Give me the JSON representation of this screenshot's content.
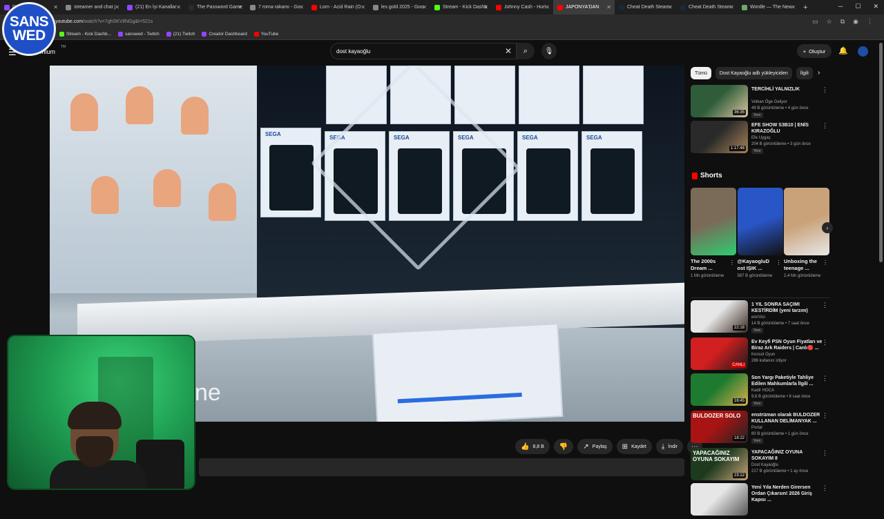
{
  "browser": {
    "tabs": [
      {
        "label": "Dash",
        "color": "#9146ff"
      },
      {
        "label": "streamer and chat j",
        "color": "#888888"
      },
      {
        "label": "(21) En İyi Kanallar",
        "color": "#9146ff"
      },
      {
        "label": "The Password Game",
        "color": "#2b2b2b"
      },
      {
        "label": "7 roma rakamı - Go",
        "color": "#888888"
      },
      {
        "label": "Lorn - Acid Rain (O",
        "color": "#ff0000"
      },
      {
        "label": "les gold 2025 - Goo",
        "color": "#888888"
      },
      {
        "label": "Stream - Kick Dashb",
        "color": "#53fc18"
      },
      {
        "label": "Johnny Cash - Hurt",
        "color": "#ff0000"
      },
      {
        "label": "JAPONYA'DAN",
        "color": "#ff0000"
      },
      {
        "label": "Cheat Death Steam",
        "color": "#1b2838"
      },
      {
        "label": "Cheat Death Steam",
        "color": "#1b2838"
      },
      {
        "label": "Wordle — The New",
        "color": "#6aaa64"
      }
    ],
    "url_host": "youtube.com",
    "url_rest": "/watch?v=7ghSKVtlNGg&t=521s",
    "bookmarks": [
      {
        "label": "Stream - Kick Dashb...",
        "color": "#53fc18"
      },
      {
        "label": "sanswed - Twitch",
        "color": "#9146ff"
      },
      {
        "label": "(21) Twitch",
        "color": "#9146ff"
      },
      {
        "label": "Creator Dashboard",
        "color": "#9146ff"
      },
      {
        "label": "YouTube",
        "color": "#ff0000"
      }
    ],
    "window_controls": [
      "─",
      "☐",
      "✕"
    ]
  },
  "overlay": {
    "logo_line1": "SANS",
    "logo_line2": "WED",
    "video_text": "ne"
  },
  "youtube": {
    "logo_text": "mium",
    "logo_sup": "TM",
    "search_value": "dost kayaoğlu",
    "create_label": "Oluştur",
    "actions": {
      "like_count": "8,8 B",
      "share": "Paylaş",
      "save": "Kaydet",
      "download": "İndir"
    },
    "chips": [
      "Tümü",
      "Dost Kayaoğlu adlı yükleyiciden",
      "İlgili"
    ],
    "top_videos": [
      {
        "title": "TERCİHLİ YALNIZLIK",
        "channel": "Volkan Öge Geliyor",
        "meta": "49 B görüntüleme • 4 gün önce",
        "badge": "Yeni",
        "duration": "36:35",
        "c1": "#2f5d3a",
        "c2": "#d9c5a0"
      },
      {
        "title": "EFE SHOW S3B10 | ENİS KIRAZOĞLU",
        "channel": "Efe Uygaç",
        "meta": "204 B görüntüleme • 3 gün önce",
        "badge": "Yeni",
        "duration": "1:17:48",
        "c1": "#2a2a2a",
        "c2": "#a88458"
      }
    ],
    "shorts_label": "Shorts",
    "shorts": [
      {
        "title": "The 2000s Dream ...",
        "views": "1 Mn görüntüleme",
        "c1": "#7a6a58",
        "c2": "#2ecc71"
      },
      {
        "title": "@KayaogluD ost IŞIK ...",
        "views": "587 B görüntüleme",
        "c1": "#2956c7",
        "c2": "#111111"
      },
      {
        "title": "Unboxing the teenage ...",
        "views": "2,4 Mn görüntüleme",
        "c1": "#c9a27a",
        "c2": "#e8e8e8"
      }
    ],
    "bottom_videos": [
      {
        "title": "1 YIL SONRA SAÇIMI KESTİRDİM (yeni tarzım)",
        "channel": "emrVici",
        "meta": "14 B görüntüleme • 7 saat önce",
        "badge": "Yeni",
        "duration": "22:18",
        "c1": "#e6e6e6",
        "c2": "#3a2a20"
      },
      {
        "title": "Ev Keyfi PSN Oyun Fiyatları ve Biraz Ark Raiders | Canlı🔴 ...",
        "channel": "Konsol Oyun",
        "meta": "286 kullanıcı izliyor",
        "badge": "",
        "duration": "CANLI",
        "live": true,
        "c1": "#d21f1f",
        "c2": "#1a1a1a"
      },
      {
        "title": "Son Yargı Paketiyle Tahliye Edilen Mahkumlarla İlgili ...",
        "channel": "Kadir HOCA",
        "meta": "9,6 B görüntüleme • 8 saat önce",
        "badge": "Yeni",
        "duration": "16:45",
        "c1": "#1e7a2e",
        "c2": "#d8b04a"
      },
      {
        "title": "enstrüman olarak BULDOZER KULLANAN DELİMANYAK ...",
        "channel": "Portal",
        "meta": "80 B görüntüleme • 1 gün önce",
        "badge": "Yeni",
        "duration": "18:22",
        "c1": "#a81414",
        "c2": "#222222",
        "thumb_text": "BULDOZER SOLO"
      },
      {
        "title": "YAPACAĞINIZ OYUNA SOKAYIM 8",
        "channel": "Dost Kayaoğlu",
        "meta": "217 B görüntüleme • 1 ay önce",
        "badge": "",
        "duration": "23:12",
        "c1": "#1e3a1e",
        "c2": "#c8a27a",
        "thumb_text": "YAPACAĞINIZ OYUNA SOKAYIM"
      },
      {
        "title": "Yeni Yıla Nerden Girersen Ordan Çıkarsın! 2026 Giriş Kapısı ...",
        "channel": "",
        "meta": "",
        "badge": "",
        "duration": "",
        "c1": "#e6e6e6",
        "c2": "#555555"
      }
    ]
  }
}
